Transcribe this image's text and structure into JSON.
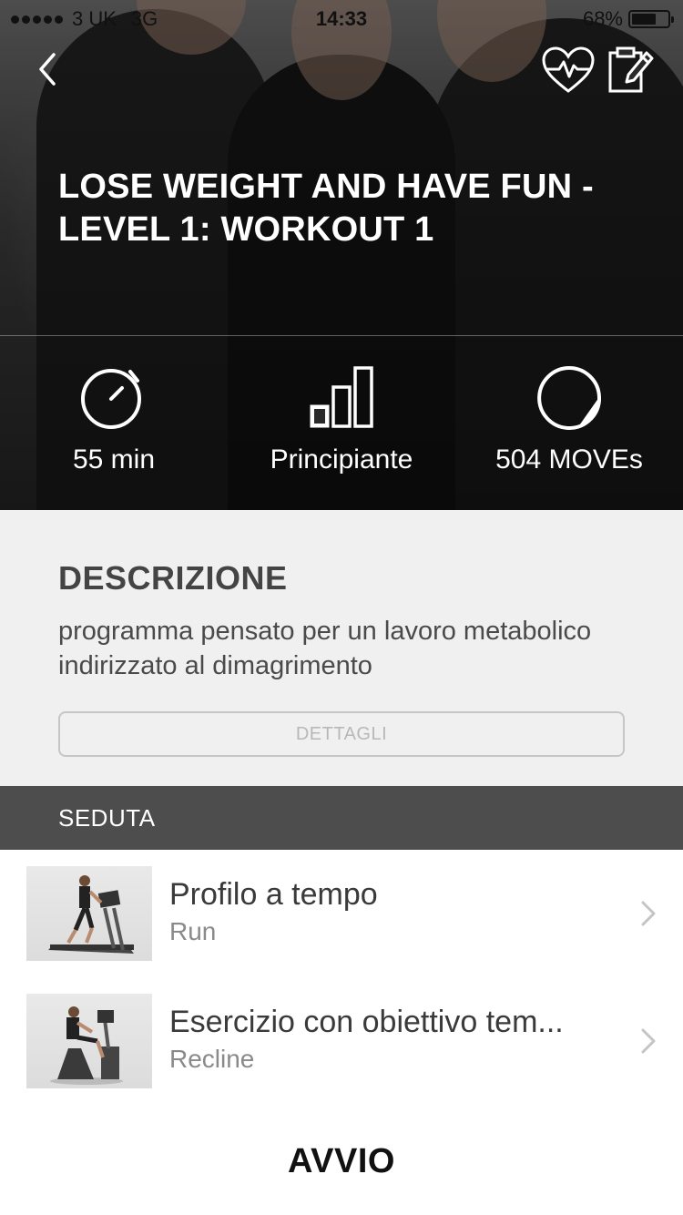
{
  "status_bar": {
    "carrier": "3 UK",
    "network": "3G",
    "time": "14:33",
    "battery_percent": "68%",
    "battery_level": 0.68
  },
  "header": {
    "back_icon": "chevron-left-icon",
    "heart_icon": "heart-rate-icon",
    "notes_icon": "clipboard-edit-icon"
  },
  "workout": {
    "title_line1": "LOSE WEIGHT AND HAVE FUN -",
    "title_line2": "LEVEL 1: WORKOUT 1"
  },
  "stats": {
    "duration": "55 min",
    "level": "Principiante",
    "moves": "504 MOVEs"
  },
  "description": {
    "heading": "DESCRIZIONE",
    "text": "programma pensato per un lavoro metabolico indirizzato al dimagrimento",
    "details_button": "DETTAGLI"
  },
  "session": {
    "heading": "SEDUTA",
    "items": [
      {
        "name": "Profilo a tempo",
        "equipment": "Run"
      },
      {
        "name": "Esercizio con obiettivo tem...",
        "equipment": "Recline"
      }
    ]
  },
  "start_button": "AVVIO"
}
